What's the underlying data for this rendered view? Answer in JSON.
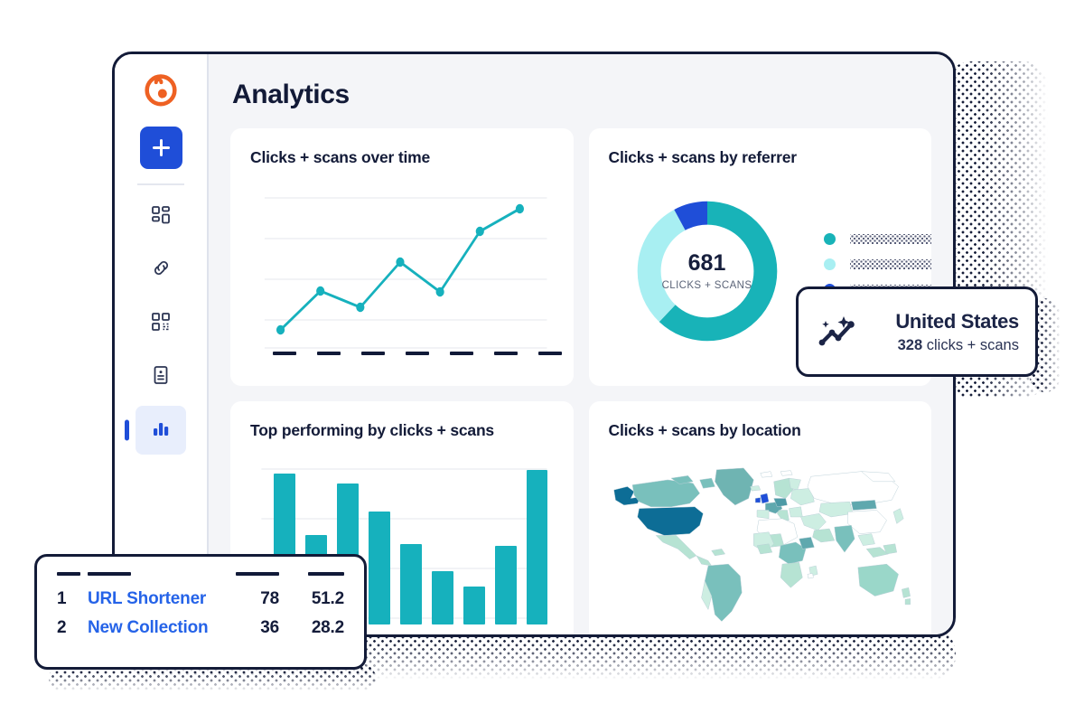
{
  "window": {
    "title": "Analytics",
    "border_color": "#131b38",
    "content_bg": "#f4f5f8"
  },
  "sidebar": {
    "brand": {
      "name": "bitly-logo",
      "color": "#ee6123"
    },
    "create_button": {
      "label": "+",
      "name": "create-new-button",
      "color": "#1f4ed8"
    },
    "items": [
      {
        "label": "Dashboard",
        "icon": "dashboard-grid-icon",
        "active": false
      },
      {
        "label": "Links",
        "icon": "link-chain-icon",
        "active": false
      },
      {
        "label": "QR Codes",
        "icon": "qr-code-icon",
        "active": false
      },
      {
        "label": "Pages",
        "icon": "id-card-icon",
        "active": false
      },
      {
        "label": "Analytics",
        "icon": "bar-chart-icon",
        "active": true
      }
    ],
    "active_color": "#1f4ed8",
    "active_bg": "#e8eefc"
  },
  "cards": {
    "line": {
      "title": "Clicks + scans over time"
    },
    "donut": {
      "title": "Clicks + scans by referrer"
    },
    "bar": {
      "title": "Top performing by clicks + scans"
    },
    "map": {
      "title": "Clicks + scans by location"
    }
  },
  "donut": {
    "center_value": "681",
    "center_label": "CLICKS + SCANS",
    "legend_labels": [
      "",
      "",
      ""
    ]
  },
  "tooltip": {
    "icon": "sparkle-trendline-icon",
    "country": "United States",
    "metric_value": "328",
    "metric_label": "clicks + scans"
  },
  "table": {
    "headers": [
      "",
      "",
      "",
      ""
    ],
    "rows": [
      {
        "rank": "1",
        "name": "URL Shortener",
        "clicks": "78",
        "rate": "51.2"
      },
      {
        "rank": "2",
        "name": "New Collection",
        "clicks": "36",
        "rate": "28.2"
      }
    ],
    "link_color": "#2563e8"
  },
  "chart_data": [
    {
      "type": "line",
      "title": "Clicks + scans over time",
      "x": [
        "",
        "",
        "",
        "",
        "",
        "",
        ""
      ],
      "values": [
        12,
        42,
        33,
        60,
        41,
        76,
        90
      ],
      "xlabel": "",
      "ylabel": "",
      "ylim": [
        0,
        100
      ],
      "grid": true,
      "legend": "none",
      "color": "#16b1bd",
      "xtick_labels_redacted": true
    },
    {
      "type": "pie",
      "title": "Clicks + scans by referrer",
      "subtitle": "681 CLICKS + SCANS",
      "total": 681,
      "labels": [
        "",
        "",
        ""
      ],
      "values": [
        62,
        30,
        8
      ],
      "colors": [
        "#18b3b8",
        "#a8eff2",
        "#1f4ed8"
      ],
      "donut": true,
      "legend": "right",
      "legend_labels_redacted": true
    },
    {
      "type": "bar",
      "title": "Top performing by clicks + scans",
      "categories": [
        "",
        "",
        "",
        "",
        "",
        "",
        "",
        ""
      ],
      "values": [
        88,
        52,
        82,
        66,
        47,
        31,
        22,
        46,
        90
      ],
      "xlabel": "",
      "ylabel": "",
      "ylim": [
        0,
        100
      ],
      "grid": true,
      "color": "#16b1bd"
    },
    {
      "type": "heatmap",
      "title": "Clicks + scans by location",
      "subtype": "choropleth-world-map",
      "highlight_region": "United States",
      "highlight_value": 328,
      "scale_colors": [
        "#cdeee2",
        "#7fc4c0",
        "#0d6d96"
      ]
    }
  ]
}
